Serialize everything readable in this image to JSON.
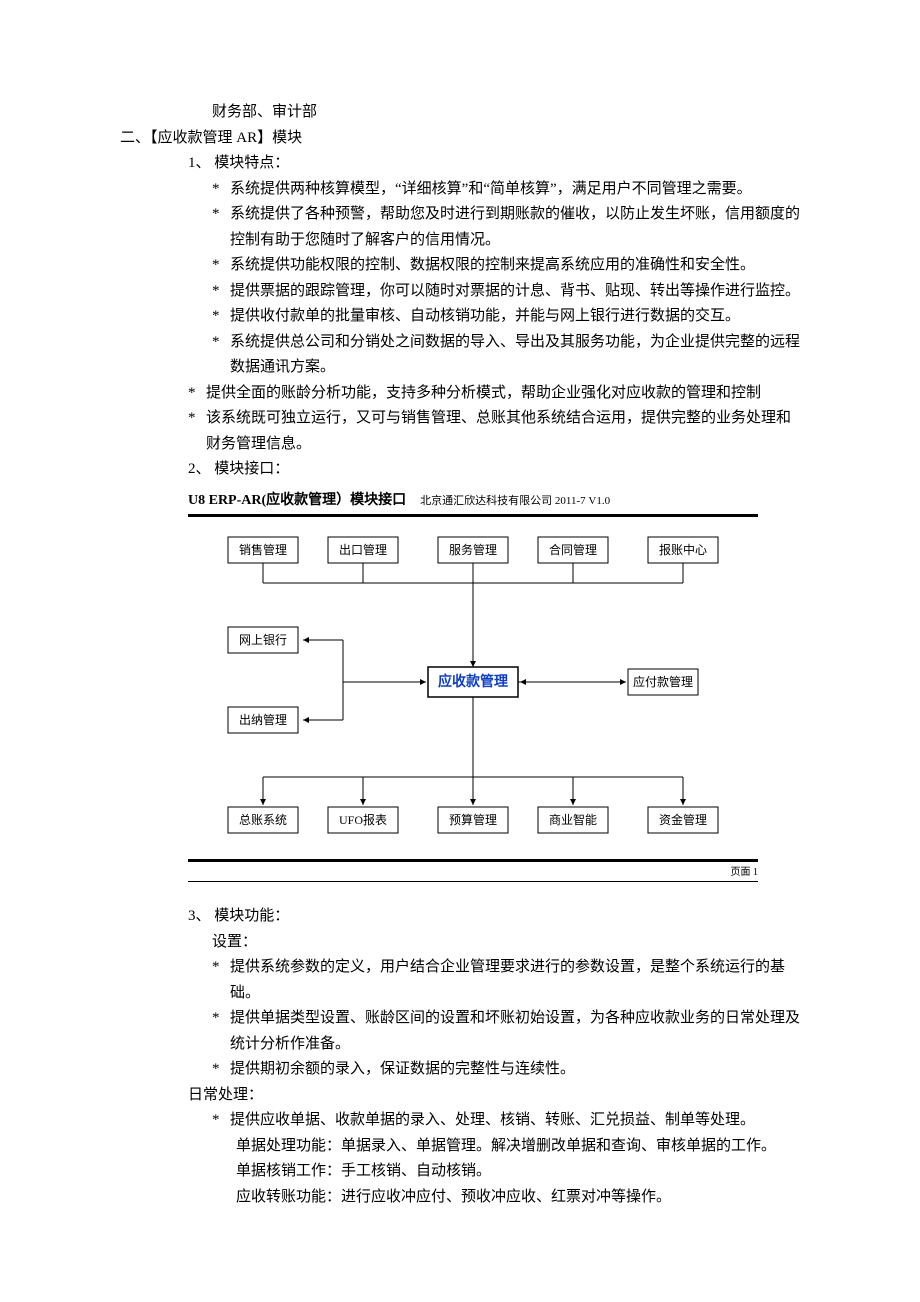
{
  "header_note": "财务部、审计部",
  "section2_title": "二、【应收款管理 AR】模块",
  "s1_title": "1、 模块特点：",
  "s1_b1": "系统提供两种核算模型，“详细核算”和“简单核算”，满足用户不同管理之需要。",
  "s1_b2": "系统提供了各种预警，帮助您及时进行到期账款的催收，以防止发生坏账，信用额度的控制有助于您随时了解客户的信用情况。",
  "s1_b3": "系统提供功能权限的控制、数据权限的控制来提高系统应用的准确性和安全性。",
  "s1_b4": "提供票据的跟踪管理，你可以随时对票据的计息、背书、贴现、转出等操作进行监控。",
  "s1_b5": "提供收付款单的批量审核、自动核销功能，并能与网上银行进行数据的交互。",
  "s1_b6": "系统提供总公司和分销处之间数据的导入、导出及其服务功能，为企业提供完整的远程数据通讯方案。",
  "s1_b7": "提供全面的账龄分析功能，支持多种分析模式，帮助企业强化对应收款的管理和控制",
  "s1_b8": "该系统既可独立运行，又可与销售管理、总账其他系统结合运用，提供完整的业务处理和财务管理信息。",
  "s2_title": "2、 模块接口：",
  "diagram": {
    "title": "U8 ERP-AR(应收款管理）模块接口",
    "subtitle": "北京通汇欣达科技有限公司  2011-7  V1.0",
    "top": [
      "销售管理",
      "出口管理",
      "服务管理",
      "合同管理",
      "报账中心"
    ],
    "left": [
      "网上银行",
      "出纳管理"
    ],
    "center": "应收款管理",
    "right": "应付款管理",
    "bottom": [
      "总账系统",
      "UFO报表",
      "预算管理",
      "商业智能",
      "资金管理"
    ],
    "footer": "页面 1"
  },
  "s3_title": "3、 模块功能：",
  "s3_set_title": "设置：",
  "s3_set_b1": "提供系统参数的定义，用户结合企业管理要求进行的参数设置，是整个系统运行的基础。",
  "s3_set_b2": "提供单据类型设置、账龄区间的设置和坏账初始设置，为各种应收款业务的日常处理及统计分析作准备。",
  "s3_set_b3": "提供期初余额的录入，保证数据的完整性与连续性。",
  "s3_daily_title": "日常处理：",
  "s3_daily_b1": "提供应收单据、收款单据的录入、处理、核销、转账、汇兑损益、制单等处理。",
  "s3_daily_line2": "单据处理功能：单据录入、单据管理。解决增删改单据和查询、审核单据的工作。",
  "s3_daily_line3": "单据核销工作：手工核销、自动核销。",
  "s3_daily_line4": "应收转账功能：进行应收冲应付、预收冲应收、红票对冲等操作。"
}
